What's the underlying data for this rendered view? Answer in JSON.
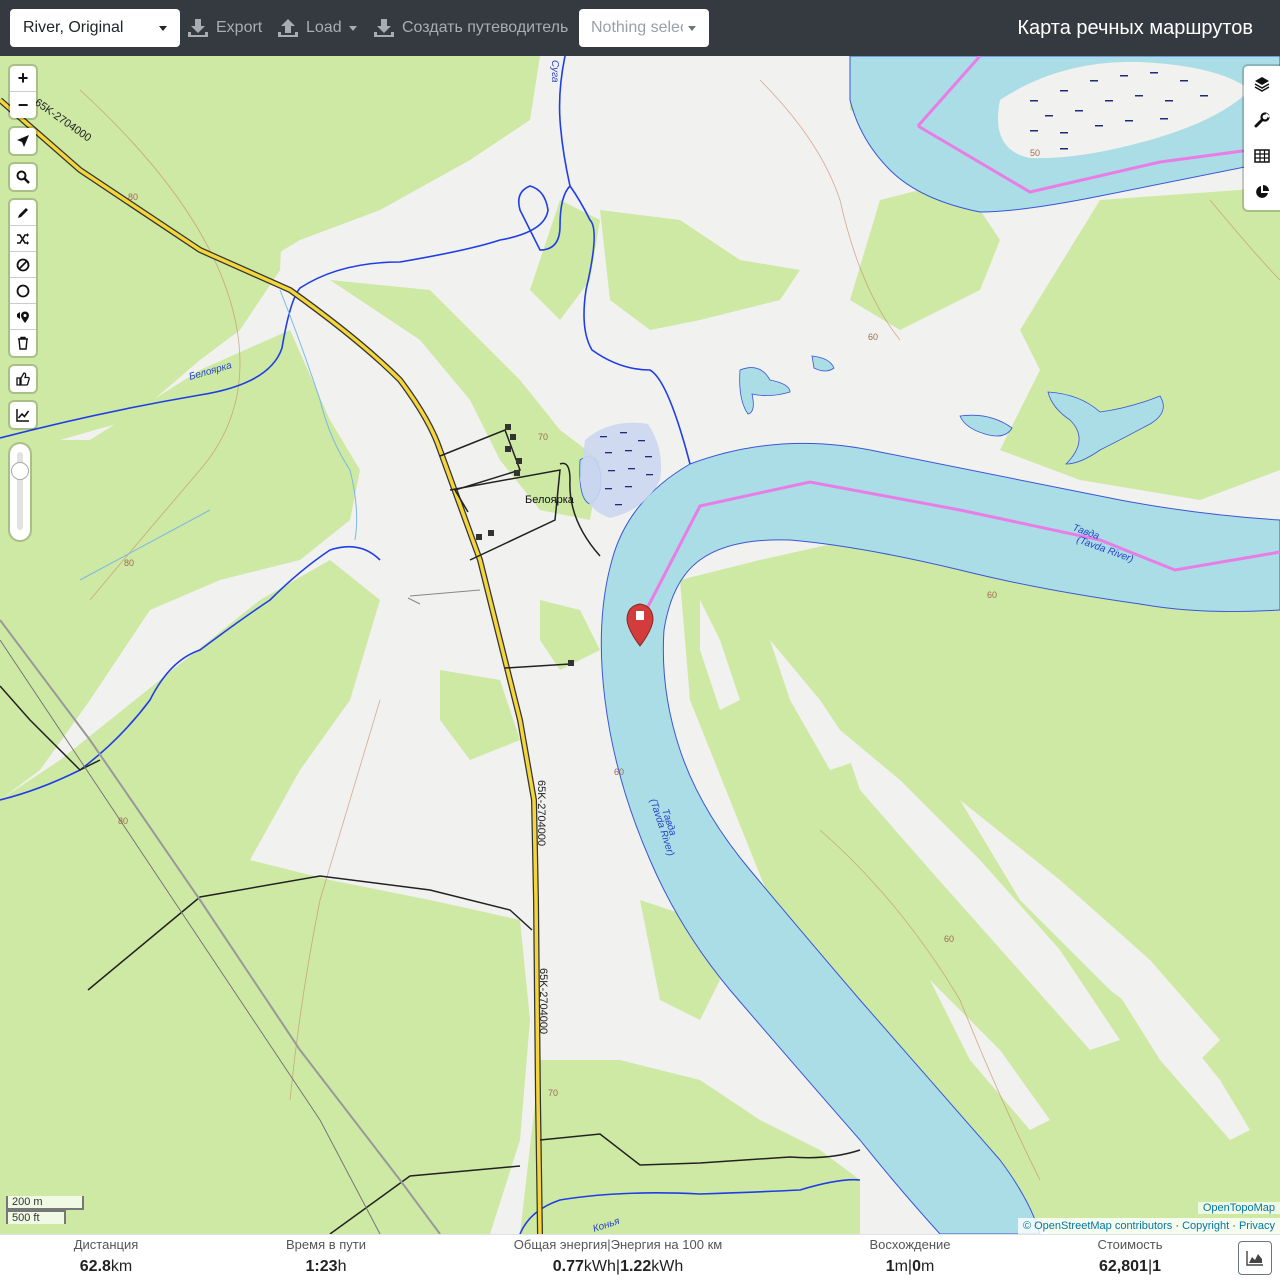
{
  "toolbar": {
    "profile": "River, Original",
    "export_label": "Export",
    "load_label": "Load",
    "guide_label": "Создать путеводитель",
    "selection_placeholder": "Nothing selected",
    "title": "Карта речных маршрутов"
  },
  "map_controls": {
    "zoom_in": "+",
    "zoom_out": "−",
    "tools": [
      "locate-icon",
      "search-icon",
      "draw-pencil-icon",
      "shuffle-icon",
      "no-entry-icon",
      "circle-icon",
      "pin-sound-icon",
      "trash-icon",
      "thumbs-up-icon",
      "elevation-chart-icon"
    ],
    "right_tools": [
      "layers-icon",
      "wrench-icon",
      "table-icon",
      "pie-chart-icon"
    ]
  },
  "map_labels": {
    "road_ref": "65K-2704000",
    "settlement": "Белоярка",
    "stream_beloyarka": "Белоярка",
    "stream_konya": "Конья",
    "stream_suga": "Суга",
    "river_name": "Тавда",
    "river_name_en": "(Tavda River)",
    "contour_50": "50",
    "contour_60": "60",
    "contour_70": "70",
    "contour_80": "80"
  },
  "scale": {
    "metric": "200 m",
    "imperial": "500 ft"
  },
  "attribution": {
    "tiles": "OpenTopoMap",
    "osm": "© OpenStreetMap contributors",
    "copyright": "Copyright",
    "privacy": "Privacy",
    "sep": " · "
  },
  "stats": {
    "distance_label": "Дистанция",
    "distance_value": "62.8",
    "distance_unit": "km",
    "time_label": "Время в пути",
    "time_value": "1:23",
    "time_unit": "h",
    "energy_label": "Общая энергия|Энергия на 100 км",
    "energy_value": "0.77",
    "energy_unit": "kWh",
    "energy_sep": "|",
    "energy100_value": "1.22",
    "energy100_unit": "kWh",
    "ascent_label": "Восхождение",
    "ascent_value": "1",
    "ascent_unit": "m",
    "ascent_sep": "|",
    "descent_value": "0",
    "descent_unit": "m",
    "cost_label": "Стоимость",
    "cost_value": "62,801",
    "cost_sep": "|",
    "cost_extra": "1"
  },
  "colors": {
    "forest": "#cde9a4",
    "river": "#aadde6",
    "stream": "#1f3ee6",
    "route": "#e97de6",
    "road": "#f5d63a",
    "topbar": "#343a40",
    "marker": "#d23c3c"
  }
}
